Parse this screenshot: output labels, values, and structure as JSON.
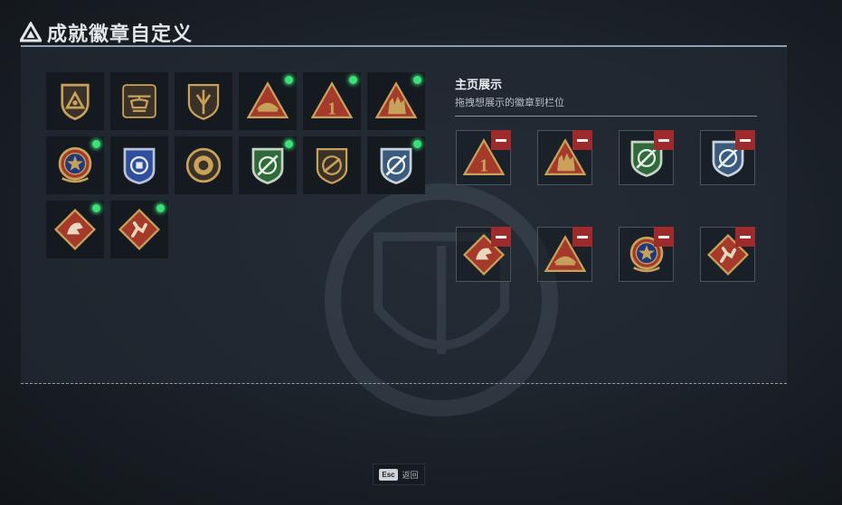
{
  "header": {
    "title": "成就徽章自定义",
    "logo_icon": "triangle-logo-icon"
  },
  "colors": {
    "accent_green": "#3ee07a",
    "remove_red": "#9e2a2c",
    "gold": "#c8a25a"
  },
  "collection": {
    "badges": [
      {
        "icon": "triangle-shield-badge-icon",
        "new": false
      },
      {
        "icon": "helicopter-badge-icon",
        "new": false
      },
      {
        "icon": "arrow-shield-badge-icon",
        "new": false
      },
      {
        "icon": "hat-triangle-badge-icon",
        "new": true
      },
      {
        "icon": "number-one-triangle-badge-icon",
        "new": true
      },
      {
        "icon": "soldiers-triangle-badge-icon",
        "new": true
      },
      {
        "icon": "star-medal-badge-icon",
        "new": true
      },
      {
        "icon": "blue-police-shield-badge-icon",
        "new": false
      },
      {
        "icon": "round-emblem-badge-icon",
        "new": false
      },
      {
        "icon": "green-crosshair-shield-badge-icon",
        "new": true
      },
      {
        "icon": "rifle-shield-badge-icon",
        "new": false
      },
      {
        "icon": "blue-crosshair-shield-badge-icon",
        "new": true
      },
      {
        "icon": "dragon-diamond-badge-icon",
        "new": true
      },
      {
        "icon": "runner-diamond-badge-icon",
        "new": true
      }
    ]
  },
  "showcase": {
    "title": "主页展示",
    "subtitle": "拖拽想展示的徽章到栏位",
    "slots": [
      {
        "icon": "number-one-triangle-badge-icon"
      },
      {
        "icon": "soldiers-triangle-badge-icon"
      },
      {
        "icon": "green-crosshair-shield-badge-icon"
      },
      {
        "icon": "blue-crosshair-shield-badge-icon"
      },
      {
        "icon": "dragon-diamond-badge-icon"
      },
      {
        "icon": "hat-triangle-badge-icon"
      },
      {
        "icon": "star-medal-badge-icon"
      },
      {
        "icon": "runner-diamond-badge-icon"
      }
    ]
  },
  "footer": {
    "key_label": "Esc",
    "back_label": "返回"
  }
}
